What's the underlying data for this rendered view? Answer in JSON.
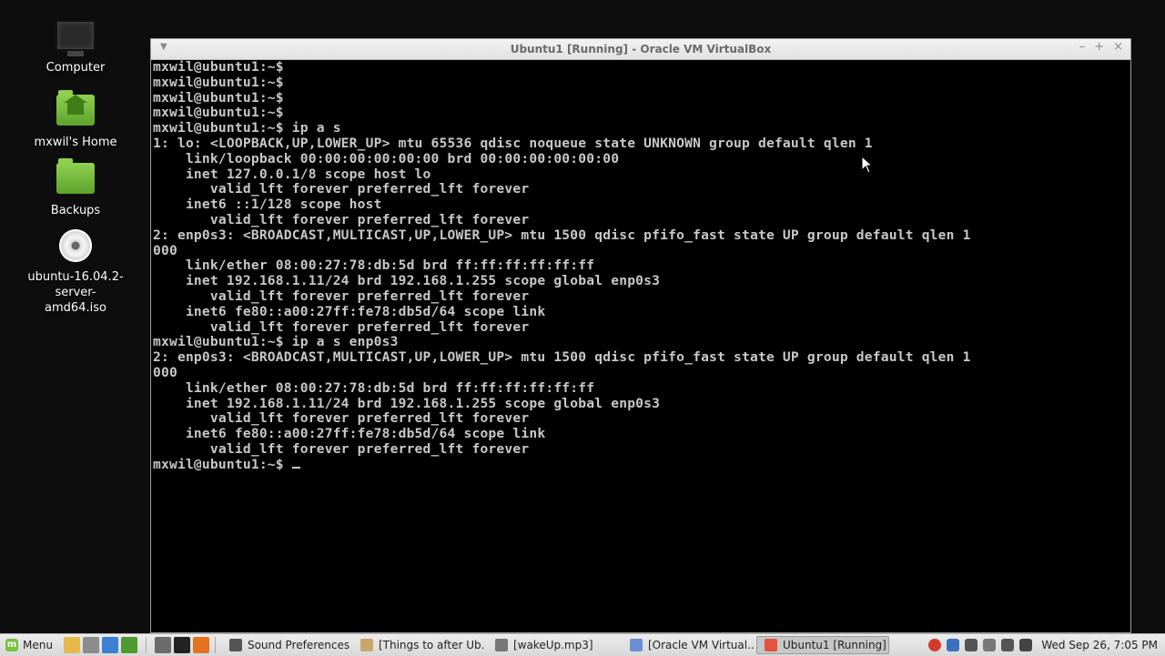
{
  "desktop": {
    "icons": [
      {
        "label": "Computer",
        "icon": "computer-icon"
      },
      {
        "label": "mxwil's Home",
        "icon": "home-folder-icon"
      },
      {
        "label": "Backups",
        "icon": "folder-icon"
      },
      {
        "label": "ubuntu-16.04.2-server-amd64.iso",
        "label_line1": "ubuntu-16.04.2-server-",
        "label_line2": "amd64.iso",
        "icon": "disc-image-icon"
      }
    ]
  },
  "window": {
    "title": "Ubuntu1 [Running] - Oracle VM VirtualBox",
    "controls": {
      "minimize": "–",
      "maximize": "+",
      "close": "×"
    }
  },
  "terminal": {
    "lines": [
      "mxwil@ubuntu1:~$",
      "mxwil@ubuntu1:~$",
      "mxwil@ubuntu1:~$",
      "mxwil@ubuntu1:~$",
      "mxwil@ubuntu1:~$ ip a s",
      "1: lo: <LOOPBACK,UP,LOWER_UP> mtu 65536 qdisc noqueue state UNKNOWN group default qlen 1",
      "    link/loopback 00:00:00:00:00:00 brd 00:00:00:00:00:00",
      "    inet 127.0.0.1/8 scope host lo",
      "       valid_lft forever preferred_lft forever",
      "    inet6 ::1/128 scope host",
      "       valid_lft forever preferred_lft forever",
      "2: enp0s3: <BROADCAST,MULTICAST,UP,LOWER_UP> mtu 1500 qdisc pfifo_fast state UP group default qlen 1",
      "000",
      "    link/ether 08:00:27:78:db:5d brd ff:ff:ff:ff:ff:ff",
      "    inet 192.168.1.11/24 brd 192.168.1.255 scope global enp0s3",
      "       valid_lft forever preferred_lft forever",
      "    inet6 fe80::a00:27ff:fe78:db5d/64 scope link",
      "       valid_lft forever preferred_lft forever",
      "mxwil@ubuntu1:~$ ip a s enp0s3",
      "2: enp0s3: <BROADCAST,MULTICAST,UP,LOWER_UP> mtu 1500 qdisc pfifo_fast state UP group default qlen 1",
      "000",
      "    link/ether 08:00:27:78:db:5d brd ff:ff:ff:ff:ff:ff",
      "    inet 192.168.1.11/24 brd 192.168.1.255 scope global enp0s3",
      "       valid_lft forever preferred_lft forever",
      "    inet6 fe80::a00:27ff:fe78:db5d/64 scope link",
      "       valid_lft forever preferred_lft forever"
    ],
    "prompt": "mxwil@ubuntu1:~$ "
  },
  "taskbar": {
    "menu_label": "Menu",
    "tasks": [
      {
        "label": "Sound Preferences",
        "icon": "sound-icon",
        "color": "#555555"
      },
      {
        "label": "[Things to after Ub...",
        "icon": "document-icon",
        "color": "#c9a66b"
      },
      {
        "label": "[wakeUp.mp3]",
        "icon": "audio-editor-icon",
        "color": "#777777"
      },
      {
        "label": "[Oracle VM Virtual...",
        "icon": "image-viewer-icon",
        "color": "#6a8fd6"
      },
      {
        "label": "Ubuntu1 [Running] ...",
        "icon": "virtualbox-icon",
        "color": "#e5533d"
      }
    ],
    "clock": "Wed Sep 26, 7:05 PM"
  },
  "colors": {
    "desktop_bg": "#0d0d0d",
    "terminal_fg": "#c8c8c8",
    "mint_green": "#7ac043"
  }
}
